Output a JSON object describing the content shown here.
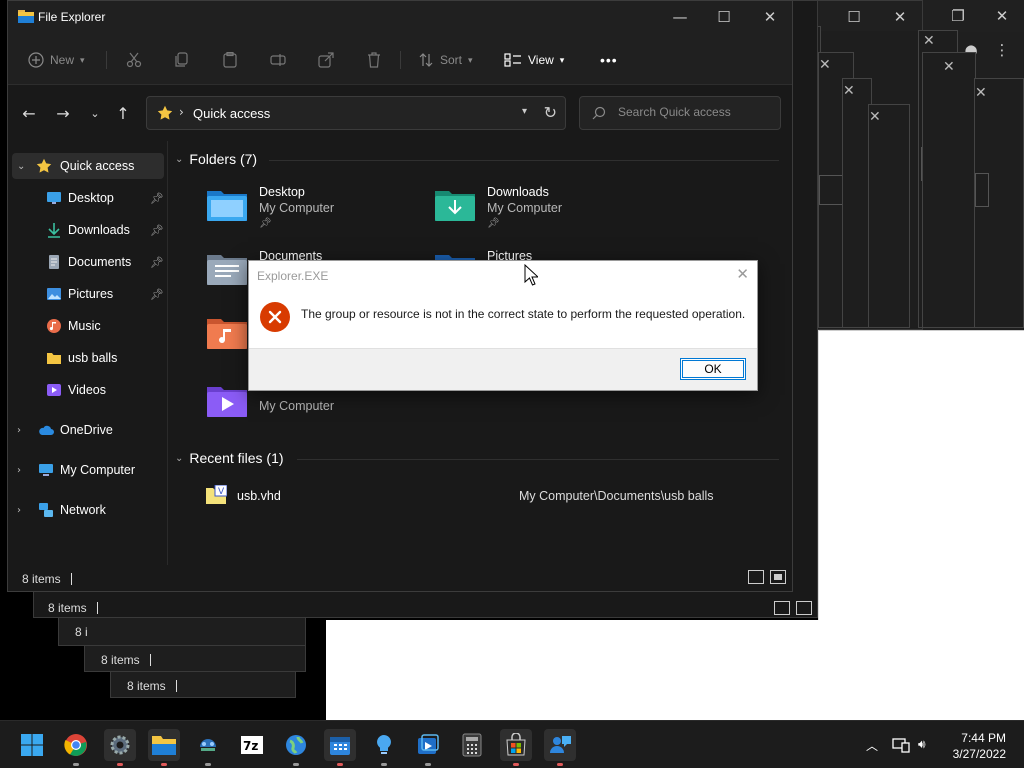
{
  "explorer": {
    "title": "File Explorer",
    "toolbar": {
      "new_label": "New",
      "sort_label": "Sort",
      "view_label": "View",
      "more_label": "•••"
    },
    "address": {
      "path": "Quick access",
      "search_placeholder": "Search Quick access"
    },
    "nav": {
      "quick_access": "Quick access",
      "pinned": [
        {
          "label": "Desktop",
          "icon": "desktop-icon",
          "pinned": true
        },
        {
          "label": "Downloads",
          "icon": "download-icon",
          "pinned": true
        },
        {
          "label": "Documents",
          "icon": "documents-icon",
          "pinned": true
        },
        {
          "label": "Pictures",
          "icon": "pictures-icon",
          "pinned": true
        },
        {
          "label": "Music",
          "icon": "music-icon",
          "pinned": false
        },
        {
          "label": "usb balls",
          "icon": "folder-icon",
          "pinned": false
        },
        {
          "label": "Videos",
          "icon": "videos-icon",
          "pinned": false
        }
      ],
      "onedrive": "OneDrive",
      "my_computer": "My Computer",
      "network": "Network"
    },
    "folders_header": "Folders (7)",
    "folders": [
      {
        "name": "Desktop",
        "location": "My Computer"
      },
      {
        "name": "Downloads",
        "location": "My Computer"
      },
      {
        "name": "Documents",
        "location": ""
      },
      {
        "name": "Pictures",
        "location": ""
      },
      {
        "name": "",
        "location": ""
      },
      {
        "name": "",
        "location": "My Computer"
      }
    ],
    "recent_header": "Recent files (1)",
    "recent": [
      {
        "name": "usb.vhd",
        "path": "My Computer\\Documents\\usb balls"
      }
    ],
    "status": "8 items"
  },
  "background_status": [
    "8 items",
    "8 i",
    "8 items",
    "8 items"
  ],
  "dialog": {
    "title": "Explorer.EXE",
    "message": "The group or resource is not in the correct state to perform the requested operation.",
    "ok_label": "OK"
  },
  "taskbar": {
    "apps": [
      "start-icon",
      "chrome-icon",
      "settings-icon",
      "file-explorer-icon",
      "connect-icon",
      "7zip-icon",
      "globe-icon",
      "calendar-icon",
      "bulb-icon",
      "media-icon",
      "calculator-icon",
      "store-icon",
      "chat-icon"
    ],
    "time": "7:44 PM",
    "date": "3/27/2022"
  },
  "colors": {
    "accent": "#0078d4",
    "error": "#d83b01",
    "folder_yellow": "#f4c542"
  }
}
